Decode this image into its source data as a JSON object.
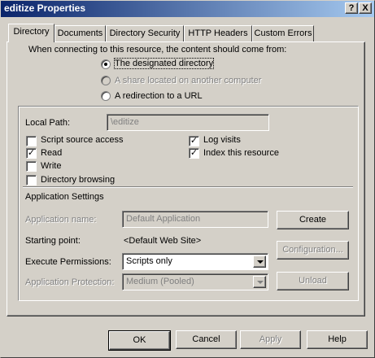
{
  "window": {
    "title": "editize Properties",
    "help_btn": "?",
    "close_btn": "X"
  },
  "tabs": [
    {
      "label": "Directory",
      "active": true
    },
    {
      "label": "Documents",
      "active": false
    },
    {
      "label": "Directory Security",
      "active": false
    },
    {
      "label": "HTTP Headers",
      "active": false
    },
    {
      "label": "Custom Errors",
      "active": false
    }
  ],
  "source": {
    "prompt": "When connecting to this resource, the content should come from:",
    "options": [
      {
        "label": "The designated directory",
        "checked": true,
        "enabled": true
      },
      {
        "label": "A share located on another computer",
        "checked": false,
        "enabled": false
      },
      {
        "label": "A redirection to a URL",
        "checked": false,
        "enabled": true
      }
    ]
  },
  "local_path": {
    "label": "Local Path:",
    "value": "\\editize"
  },
  "checks_left": [
    {
      "label": "Script source access",
      "checked": false
    },
    {
      "label": "Read",
      "checked": true
    },
    {
      "label": "Write",
      "checked": false
    },
    {
      "label": "Directory browsing",
      "checked": false
    }
  ],
  "checks_right": [
    {
      "label": "Log visits",
      "checked": true
    },
    {
      "label": "Index this resource",
      "checked": true
    }
  ],
  "app_settings": {
    "heading": "Application Settings",
    "app_name_label": "Application name:",
    "app_name_value": "Default Application",
    "create_btn": "Create",
    "starting_point_label": "Starting point:",
    "starting_point_value": "<Default Web Site>",
    "configuration_btn": "Configuration...",
    "exec_perm_label": "Execute Permissions:",
    "exec_perm_value": "Scripts only",
    "app_protection_label": "Application Protection:",
    "app_protection_value": "Medium (Pooled)",
    "unload_btn": "Unload"
  },
  "footer": {
    "ok": "OK",
    "cancel": "Cancel",
    "apply": "Apply",
    "help": "Help"
  }
}
